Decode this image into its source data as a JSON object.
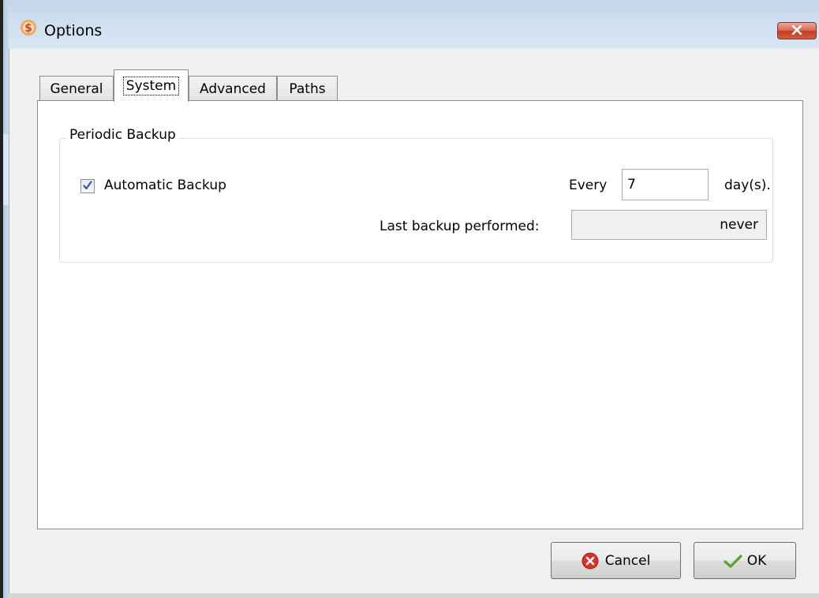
{
  "window": {
    "title": "Options",
    "icon": "app-dollar-icon",
    "close_icon": "close-x-icon"
  },
  "tabs": [
    {
      "label": "General",
      "active": false
    },
    {
      "label": "System",
      "active": true
    },
    {
      "label": "Advanced",
      "active": false
    },
    {
      "label": "Paths",
      "active": false
    }
  ],
  "periodic_backup": {
    "legend": "Periodic Backup",
    "automatic_backup_label": "Automatic Backup",
    "automatic_backup_checked": true,
    "every_label": "Every",
    "every_value": "7",
    "days_label": "day(s).",
    "last_backup_label": "Last backup performed:",
    "last_backup_value": "never"
  },
  "buttons": {
    "cancel_label": "Cancel",
    "ok_label": "OK"
  },
  "colors": {
    "titlebar": "#cfdff0",
    "close_button": "#d9674f",
    "cancel_icon": "#d8332b",
    "ok_icon": "#5aa02c"
  }
}
